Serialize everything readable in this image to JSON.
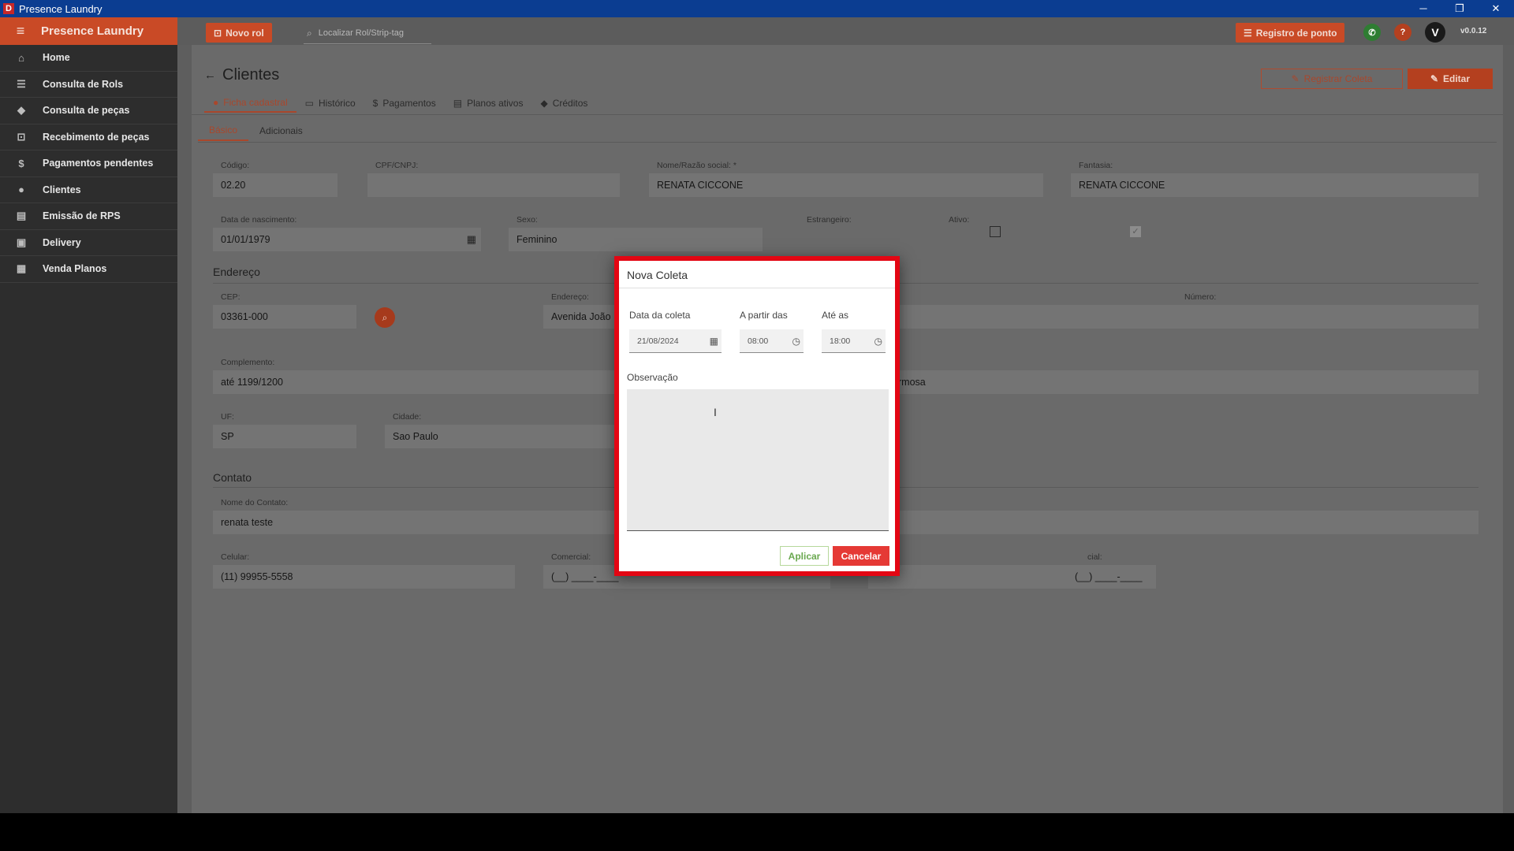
{
  "window": {
    "app_icon": "D",
    "title": "Presence Laundry",
    "minimize": "─",
    "maximize": "❐",
    "close": "✕"
  },
  "sidebar": {
    "brand": "Presence Laundry",
    "items": [
      {
        "label": "Home",
        "icon": "home-icon"
      },
      {
        "label": "Consulta de Rols",
        "icon": "list-check-icon"
      },
      {
        "label": "Consulta de peças",
        "icon": "tag-icon"
      },
      {
        "label": "Recebimento de peças",
        "icon": "cart-icon"
      },
      {
        "label": "Pagamentos pendentes",
        "icon": "dollar-circle-icon"
      },
      {
        "label": "Clientes",
        "icon": "person-icon"
      },
      {
        "label": "Emissão de RPS",
        "icon": "document-icon"
      },
      {
        "label": "Delivery",
        "icon": "truck-icon"
      },
      {
        "label": "Venda Planos",
        "icon": "basket-icon"
      }
    ]
  },
  "appbar": {
    "novo_rol": "Novo rol",
    "search_placeholder": "Localizar Rol/Strip-tag",
    "registro_ponto": "Registro de ponto",
    "avatar_letter": "V",
    "version": "v0.0.12"
  },
  "page": {
    "title": "Clientes",
    "registrar_coleta": "Registrar Coleta",
    "editar": "Editar",
    "tabs": [
      "Ficha cadastral",
      "Histórico",
      "Pagamentos",
      "Planos ativos",
      "Créditos"
    ],
    "subtabs": [
      "Básico",
      "Adicionais"
    ]
  },
  "form": {
    "codigo": {
      "label": "Código:",
      "value": "02.20"
    },
    "cpf": {
      "label": "CPF/CNPJ:",
      "value": ""
    },
    "nome": {
      "label": "Nome/Razão social: *",
      "value": "RENATA CICCONE"
    },
    "fantasia": {
      "label": "Fantasia:",
      "value": "RENATA CICCONE"
    },
    "nascimento": {
      "label": "Data de nascimento:",
      "value": "01/01/1979"
    },
    "sexo": {
      "label": "Sexo:",
      "value": "Feminino"
    },
    "estrangeiro": {
      "label": "Estrangeiro:",
      "checked": false
    },
    "ativo": {
      "label": "Ativo:",
      "checked": true
    },
    "endereco_section": "Endereço",
    "cep": {
      "label": "CEP:",
      "value": "03361-000"
    },
    "endereco": {
      "label": "Endereço:",
      "value": "Avenida João"
    },
    "numero": {
      "label": "Número:",
      "value": ""
    },
    "complemento": {
      "label": "Complemento:",
      "value": "até 1199/1200"
    },
    "bairro": {
      "value": "rmosa"
    },
    "uf": {
      "label": "UF:",
      "value": "SP"
    },
    "cidade": {
      "label": "Cidade:",
      "value": "Sao Paulo"
    },
    "contato_section": "Contato",
    "nome_contato": {
      "label": "Nome do Contato:",
      "value": "renata teste"
    },
    "celular": {
      "label": "Celular:",
      "value": "(11) 99955-5558"
    },
    "comercial": {
      "label": "Comercial:",
      "value": "(__) ____-____"
    },
    "residencial": {
      "label": "cial:",
      "value": "(__) ____-____"
    }
  },
  "dialog": {
    "title": "Nova Coleta",
    "data_label": "Data da coleta",
    "data_value": "21/08/2024",
    "de_label": "A partir das",
    "de_value": "08:00",
    "ate_label": "Até as",
    "ate_value": "18:00",
    "obs_label": "Observação",
    "obs_value": "",
    "aplicar": "Aplicar",
    "cancelar": "Cancelar"
  },
  "colors": {
    "brand": "#c94a26",
    "dialog_border": "#e30613",
    "cancel": "#e53935",
    "apply": "#6aa84f"
  }
}
